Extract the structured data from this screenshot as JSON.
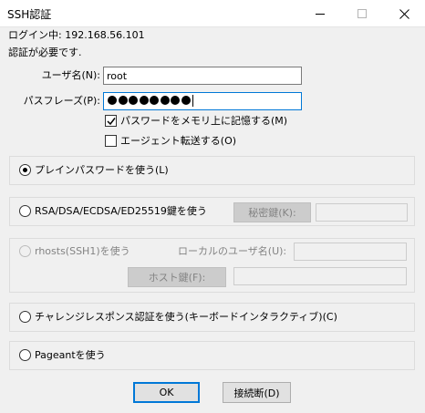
{
  "window": {
    "title": "SSH認証",
    "minimize_icon": "minimize-icon",
    "maximize_icon": "maximize-icon",
    "close_icon": "close-icon"
  },
  "info": {
    "login_line": "ログイン中: 192.168.56.101",
    "auth_required": "認証が必要です."
  },
  "form": {
    "username_label": "ユーザ名(N):",
    "username_value": "root",
    "passphrase_label": "パスフレーズ(P):",
    "passphrase_masked_count": 8,
    "remember_password_label": "パスワードをメモリ上に記憶する(M)",
    "remember_password_checked": true,
    "agent_forward_label": "エージェント転送する(O)",
    "agent_forward_checked": false
  },
  "methods": {
    "plain_password_label": "プレインパスワードを使う(L)",
    "plain_password_selected": true,
    "rsa_label": "RSA/DSA/ECDSA/ED25519鍵を使う",
    "private_key_button": "秘密鍵(K):",
    "rhosts_label": "rhosts(SSH1)を使う",
    "local_user_label": "ローカルのユーザ名(U):",
    "host_key_button": "ホスト鍵(F):",
    "challenge_label": "チャレンジレスポンス認証を使う(キーボードインタラクティブ)(C)",
    "pageant_label": "Pageantを使う"
  },
  "buttons": {
    "ok": "OK",
    "disconnect": "接続断(D)"
  }
}
